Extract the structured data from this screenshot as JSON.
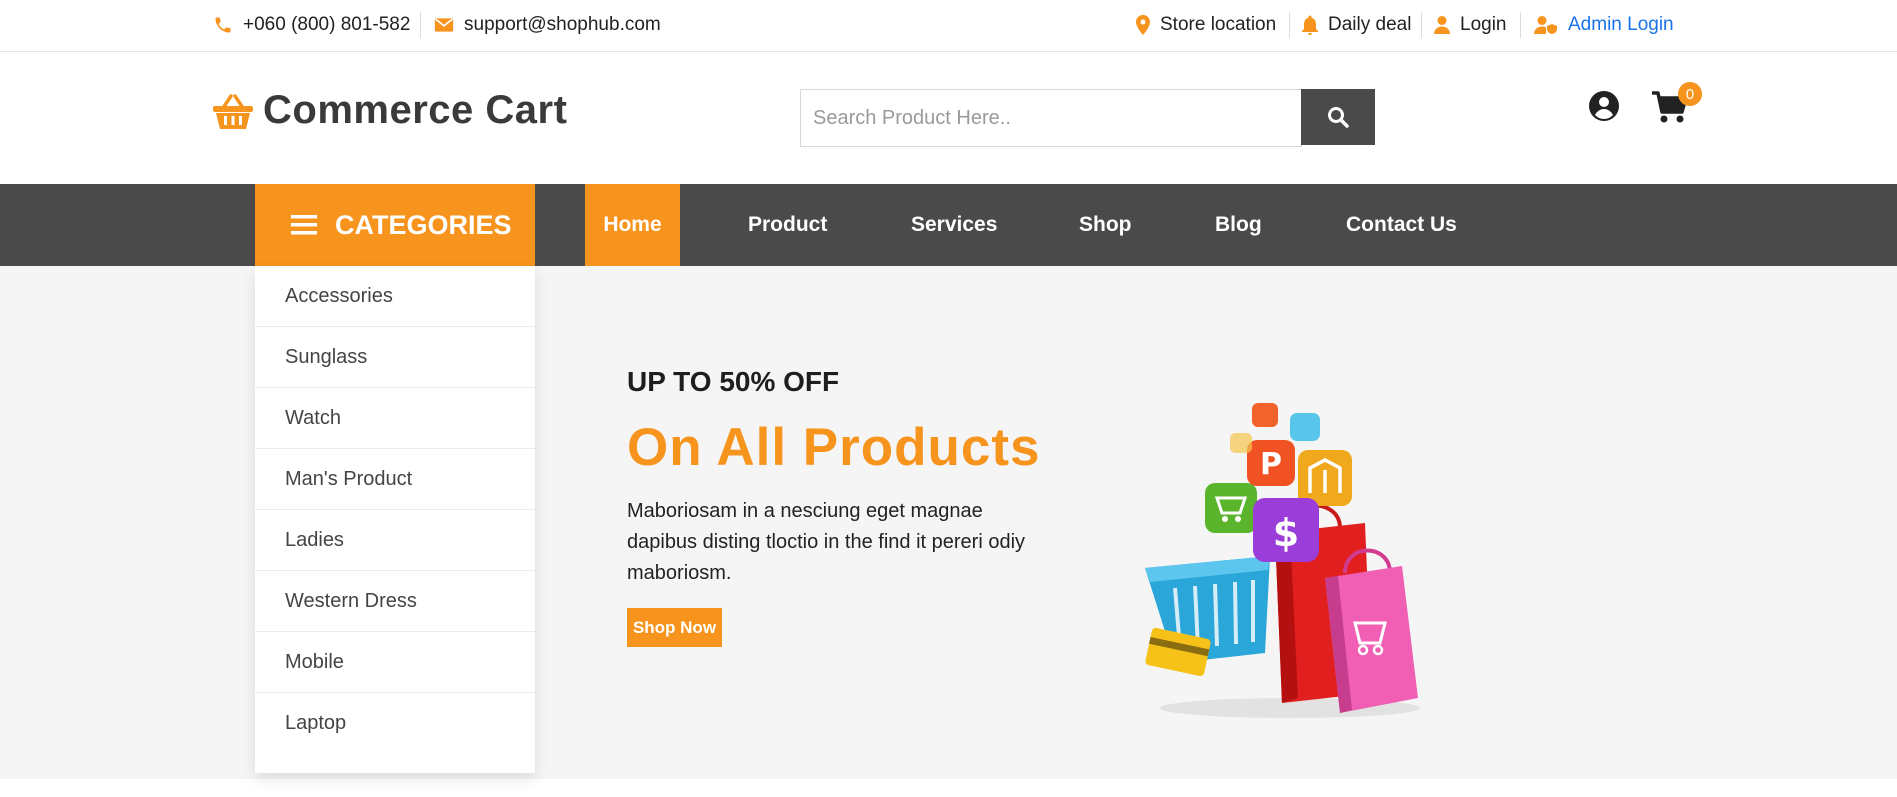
{
  "topbar": {
    "phone": "+060 (800) 801-582",
    "email": "support@shophub.com",
    "store_location": "Store location",
    "daily_deal": "Daily deal",
    "login": "Login",
    "admin_login": "Admin Login"
  },
  "header": {
    "logo_text": "Commerce Cart",
    "search_placeholder": "Search Product Here..",
    "cart_count": "0"
  },
  "nav": {
    "categories_label": "CATEGORIES",
    "links": [
      "Home",
      "Product",
      "Services",
      "Shop",
      "Blog",
      "Contact Us"
    ],
    "active": "Home"
  },
  "categories": [
    "Accessories",
    "Sunglass",
    "Watch",
    "Man's Product",
    "Ladies",
    "Western Dress",
    "Mobile",
    "Laptop"
  ],
  "hero": {
    "kicker": "UP TO 50% OFF",
    "title": "On All Products",
    "description": "Maboriosam in a nesciung eget magnae dapibus disting tloctio in the find it pereri odiy maboriosm.",
    "button": "Shop Now"
  },
  "colors": {
    "accent": "#f7941d",
    "nav_bg": "#4a4a4a",
    "hero_bg": "#f5f5f5",
    "admin_link": "#1a73e8"
  },
  "icons": {
    "phone": "phone-icon",
    "email": "envelope-icon",
    "store": "map-pin-icon",
    "deal": "bell-icon",
    "login": "user-icon",
    "admin": "user-shield-icon",
    "logo": "basket-icon",
    "search": "search-icon",
    "account": "user-circle-icon",
    "cart": "cart-icon",
    "menu": "hamburger-icon"
  }
}
